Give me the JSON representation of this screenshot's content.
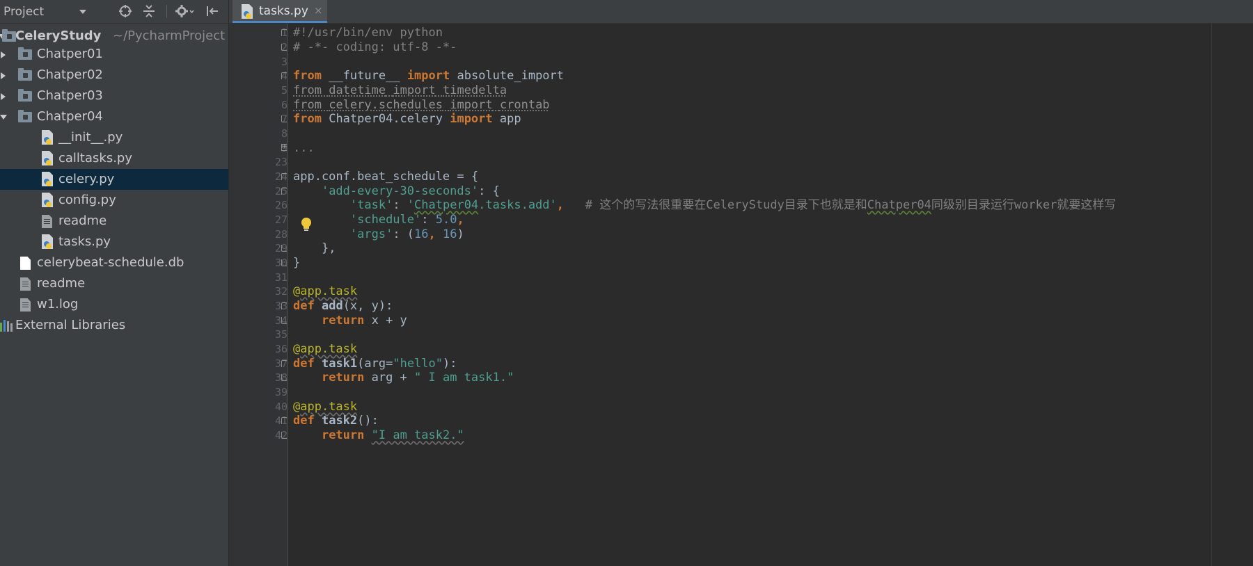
{
  "sidebar": {
    "view_label": "Project",
    "tree": [
      {
        "label": "CeleryStudy",
        "hint": "~/PycharmProject",
        "kind": "root"
      },
      {
        "label": "Chatper01",
        "kind": "folder"
      },
      {
        "label": "Chatper02",
        "kind": "folder"
      },
      {
        "label": "Chatper03",
        "kind": "folder"
      },
      {
        "label": "Chatper04",
        "kind": "folder-open"
      },
      {
        "label": "__init__.py",
        "kind": "python"
      },
      {
        "label": "calltasks.py",
        "kind": "python"
      },
      {
        "label": "celery.py",
        "kind": "python",
        "selected": true
      },
      {
        "label": "config.py",
        "kind": "python"
      },
      {
        "label": "readme",
        "kind": "text"
      },
      {
        "label": "tasks.py",
        "kind": "python"
      },
      {
        "label": "celerybeat-schedule.db",
        "kind": "file"
      },
      {
        "label": "readme",
        "kind": "text"
      },
      {
        "label": "w1.log",
        "kind": "text"
      },
      {
        "label": "External Libraries",
        "kind": "library"
      }
    ]
  },
  "tabs": [
    {
      "label": "tasks.py",
      "close": "×"
    }
  ],
  "editor": {
    "line_numbers": [
      "1",
      "2",
      "3",
      "4",
      "5",
      "6",
      "7",
      "8",
      "9",
      "23",
      "24",
      "25",
      "26",
      "27",
      "28",
      "29",
      "30",
      "31",
      "32",
      "33",
      "34",
      "35",
      "36",
      "37",
      "38",
      "39",
      "40",
      "41",
      "42"
    ],
    "lines": [
      "#!/usr/bin/env python",
      "# -*- coding: utf-8 -*-",
      "",
      "from __future__ import absolute_import",
      "from datetime import timedelta",
      "from celery.schedules import crontab",
      "from Chatper04.celery import app",
      "",
      "...",
      "",
      "app.conf.beat_schedule = {",
      "    'add-every-30-seconds': {",
      "        'task': 'Chatper04.tasks.add',   # 这个的写法很重要在CeleryStudy目录下也就是和Chatper04同级别目录运行worker就要这样写",
      "        'schedule': 5.0,",
      "        'args': (16, 16)",
      "    },",
      "}",
      "",
      "@app.task",
      "def add(x, y):",
      "    return x + y",
      "",
      "@app.task",
      "def task1(arg=\"hello\"):",
      "    return arg + \" I am task1.\"",
      "",
      "@app.task",
      "def task2():",
      "    return \"I am task2.\""
    ],
    "tokens": {
      "shebang": "#!/usr/bin/env python",
      "coding": "# -*- coding: utf-8 -*-",
      "from": "from",
      "import": "import",
      "future": "__future__",
      "absolute_import": "absolute_import",
      "datetime": "datetime",
      "timedelta": "timedelta",
      "celery_schedules": "celery.schedules",
      "crontab": "crontab",
      "chatper04_celery": "Chatper04.celery",
      "app": "app",
      "folded": "...",
      "beat_schedule": "app.conf.beat_schedule = {",
      "add_every": "'add-every-30-seconds'",
      "colon_brace": ": {",
      "task_key": "'task'",
      "colon": ": ",
      "task_val_q1": "'",
      "task_val_word": "Chatper04",
      "task_val_rest": ".tasks.add'",
      "comma": ",",
      "comment_a": "# 这个的写法很重要在CeleryStudy目录下也就是和",
      "comment_b": "Chatper04",
      "comment_c": "同级别目录运行worker就要这样写",
      "schedule_key": "'schedule'",
      "schedule_val": "5.0",
      "args_key": "'args'",
      "args_open": ": (",
      "sixteen": "16",
      "args_sep": ", ",
      "args_close": ")",
      "close_inner": "},",
      "close_outer": "}",
      "at": "@",
      "app_task": "app.task",
      "def": "def",
      "return": "return",
      "add_fn": "add",
      "add_args": "(x, y):",
      "add_ret": " x + y",
      "task1_fn": "task1",
      "task1_args_a": "(arg=",
      "hello": "\"hello\"",
      "task1_args_b": "):",
      "task1_ret_a": " arg + ",
      "task1_ret_b": "\" I am task1.\"",
      "task2_fn": "task2",
      "task2_args": "():",
      "task2_ret": "\"I am task2.\""
    }
  },
  "colors": {
    "keyword": "#cc7832",
    "string": "#4f9e8f",
    "number": "#6897bb",
    "comment": "#808080",
    "decorator": "#bbb529",
    "selection": "#0d293e"
  },
  "icons": {
    "locate": "crosshair-icon",
    "collapse": "collapse-all-icon",
    "settings": "gear-icon",
    "hide": "hide-panel-icon",
    "intention": "lightbulb-icon"
  }
}
